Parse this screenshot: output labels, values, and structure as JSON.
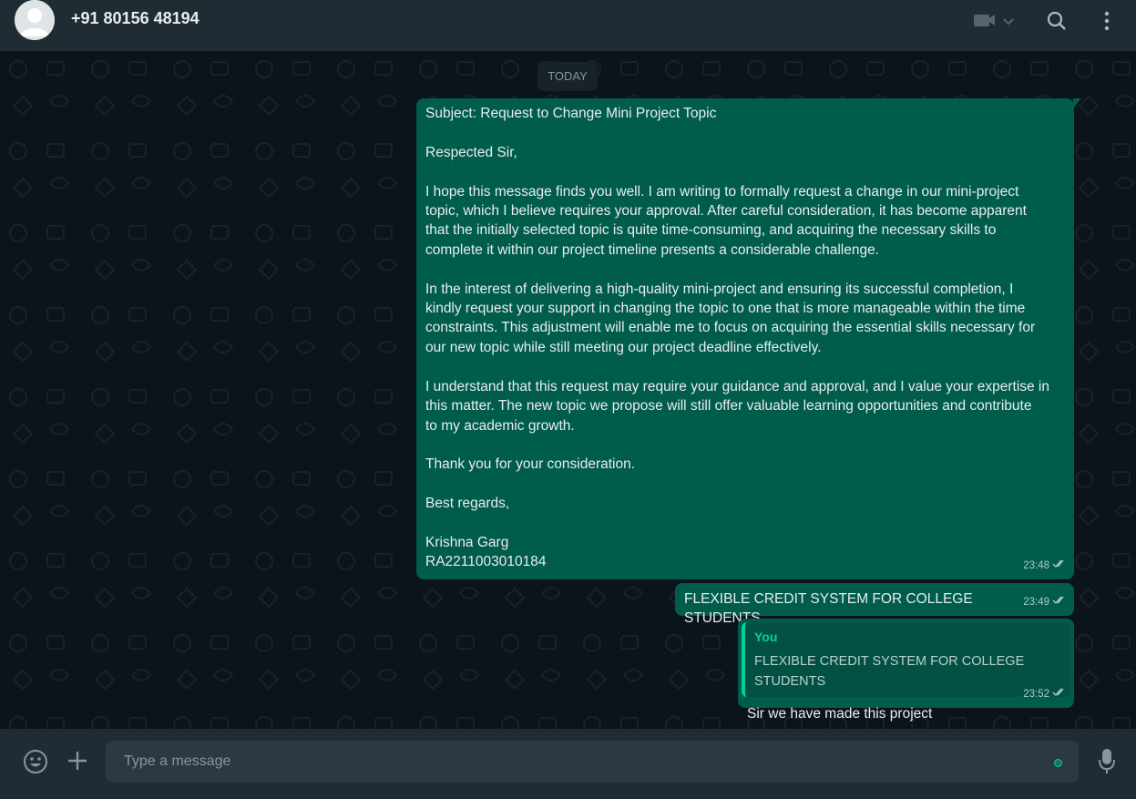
{
  "header": {
    "contact_name": "+91 80156 48194",
    "icons": [
      "avatar-icon",
      "video-call-icon",
      "chevron-down-icon",
      "search-icon",
      "menu-icon"
    ]
  },
  "chat": {
    "date_label": "TODAY",
    "messages": [
      {
        "text": "Subject: Request to Change Mini Project Topic\n\nRespected Sir,\n\nI hope this message finds you well. I am writing to formally request a change in our mini-project\ntopic, which I believe requires your approval. After careful consideration, it has become apparent\nthat the initially selected topic is quite time-consuming, and acquiring the necessary skills to\ncomplete it within our project timeline presents a considerable challenge.\n\nIn the interest of delivering a high-quality mini-project and ensuring its successful completion, I\nkindly request your support in changing the topic to one that is more manageable within the time\nconstraints. This adjustment will enable me to focus on acquiring the essential skills necessary for\nour new topic while still meeting our project deadline effectively.\n\nI understand that this request may require your guidance and approval, and I value your expertise in\nthis matter. The new topic we propose will still offer valuable learning opportunities and contribute\nto my academic growth.\n\nThank you for your consideration.\n\nBest regards,\n\nKrishna Garg\nRA2211003010184",
        "time": "23:48",
        "status": "read-ticks"
      },
      {
        "text": "FLEXIBLE CREDIT SYSTEM FOR COLLEGE STUDENTS",
        "time": "23:49",
        "status": "read-ticks"
      },
      {
        "quote_author": "You",
        "quote_text": "FLEXIBLE CREDIT SYSTEM FOR COLLEGE STUDENTS",
        "text": "Sir we have made this project",
        "time": "23:52",
        "status": "read-ticks"
      }
    ]
  },
  "footer": {
    "placeholder": "Type a message",
    "icons": [
      "emoji-icon",
      "plus-icon",
      "microphone-icon"
    ]
  },
  "colors": {
    "header_bg": "#202c33",
    "chat_bg": "#0b141a",
    "outgoing_bubble": "#005c4b",
    "accent": "#06cf9c"
  }
}
